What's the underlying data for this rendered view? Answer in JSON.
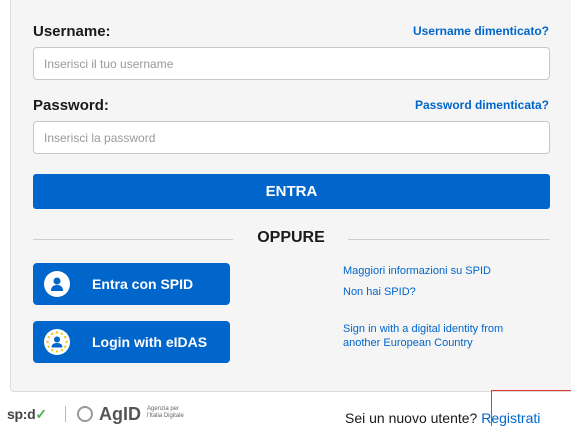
{
  "login": {
    "username_label": "Username:",
    "username_forgot": "Username dimenticato?",
    "username_placeholder": "Inserisci il tuo username",
    "username_value": "",
    "password_label": "Password:",
    "password_forgot": "Password dimenticata?",
    "password_placeholder": "Inserisci la password",
    "password_value": "",
    "submit_label": "ENTRA",
    "divider_text": "OPPURE"
  },
  "alternatives": {
    "spid": {
      "button_label": "Entra con SPID",
      "info_link": "Maggiori informazioni su SPID",
      "no_spid_link": "Non hai SPID?"
    },
    "eidas": {
      "button_label": "Login with eIDAS",
      "info_line1": "Sign in with a digital identity from",
      "info_line2": "another European Country"
    }
  },
  "footer": {
    "spid_logo_text": "sp:d",
    "spid_logo_check": "✓",
    "agid_logo_text": "AgID",
    "agid_sub_line1": "Agenzia per",
    "agid_sub_line2": "l'Italia Digitale",
    "new_user_text": "Sei un nuovo utente? ",
    "register_link": "Registrati"
  },
  "colors": {
    "primary": "#0066cc",
    "card_bg": "#f5f5f5",
    "highlight": "#e53935"
  }
}
